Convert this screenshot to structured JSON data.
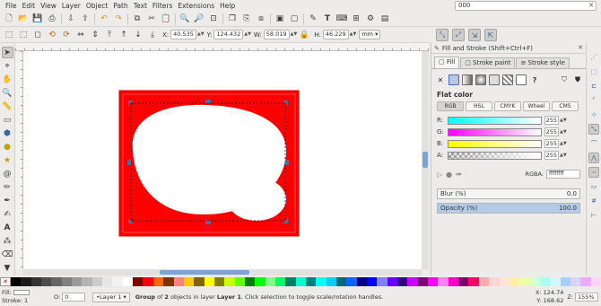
{
  "menubar": {
    "items": [
      "File",
      "Edit",
      "View",
      "Layer",
      "Object",
      "Path",
      "Text",
      "Filters",
      "Extensions",
      "Help"
    ],
    "search_value": "000"
  },
  "controls": {
    "x_label": "X:",
    "x_value": "40.535",
    "y_label": "Y:",
    "y_value": "124.432",
    "w_label": "W:",
    "w_value": "58.019",
    "h_label": "H:",
    "h_value": "46.229",
    "unit": "mm"
  },
  "dock": {
    "title": "Fill and Stroke (Shift+Ctrl+F)",
    "tabs": [
      "Fill",
      "Stroke paint",
      "Stroke style"
    ],
    "flat_color_label": "Flat color",
    "modes": [
      "RGB",
      "HSL",
      "CMYK",
      "Wheel",
      "CMS"
    ],
    "channels": [
      {
        "label": "R:",
        "value": "255"
      },
      {
        "label": "G:",
        "value": "255"
      },
      {
        "label": "B:",
        "value": "255"
      },
      {
        "label": "A:",
        "value": "255"
      }
    ],
    "rgba_label": "RGBA:",
    "rgba_value": "ffffffff",
    "blur_label": "Blur (%)",
    "blur_value": "0.0",
    "opacity_label": "Opacity (%)",
    "opacity_value": "100.0"
  },
  "status": {
    "fill_label": "Fill:",
    "stroke_label": "Stroke:",
    "stroke_value": "1",
    "opacity_label": "O:",
    "opacity_value": "0",
    "layer": "•Layer 1",
    "message_bold": "Group",
    "message_1": " of ",
    "message_bold2": "2",
    "message_2": " objects in layer ",
    "message_bold3": "Layer 1",
    "message_3": ". Click selection to toggle scale/rotation handles.",
    "cursor_x_label": "X:",
    "cursor_x": "124.74",
    "cursor_y_label": "Y:",
    "cursor_y": "168.62",
    "zoom_label": "Z:",
    "zoom_value": "155%"
  },
  "colors": {
    "selected_fill": "#ff0000",
    "accent": "#4a6da7"
  },
  "palette": [
    "#000000",
    "#1a1a1a",
    "#333333",
    "#4d4d4d",
    "#666666",
    "#808080",
    "#999999",
    "#b3b3b3",
    "#cccccc",
    "#e6e6e6",
    "#f2f2f2",
    "#ffffff",
    "#800000",
    "#ff0000",
    "#ff6600",
    "#803300",
    "#ff8080",
    "#ffcc00",
    "#806600",
    "#ffff00",
    "#808000",
    "#ccff00",
    "#66ff00",
    "#008000",
    "#00ff00",
    "#80ff80",
    "#00ff66",
    "#008066",
    "#00ffcc",
    "#008080",
    "#00ffff",
    "#00ccff",
    "#006680",
    "#0066ff",
    "#000080",
    "#0000ff",
    "#8080ff",
    "#6600ff",
    "#330080",
    "#cc00ff",
    "#800080",
    "#ff00ff",
    "#ff80ff",
    "#ff00cc",
    "#800066",
    "#ff0066",
    "#ffaaaa",
    "#ffd5d5",
    "#ffe6d5",
    "#ffeeaa",
    "#eeffaa",
    "#d5ffd5",
    "#aaffee",
    "#d5f6ff",
    "#aaccff",
    "#d5d5ff",
    "#eeaaff",
    "#ffd5f6"
  ]
}
